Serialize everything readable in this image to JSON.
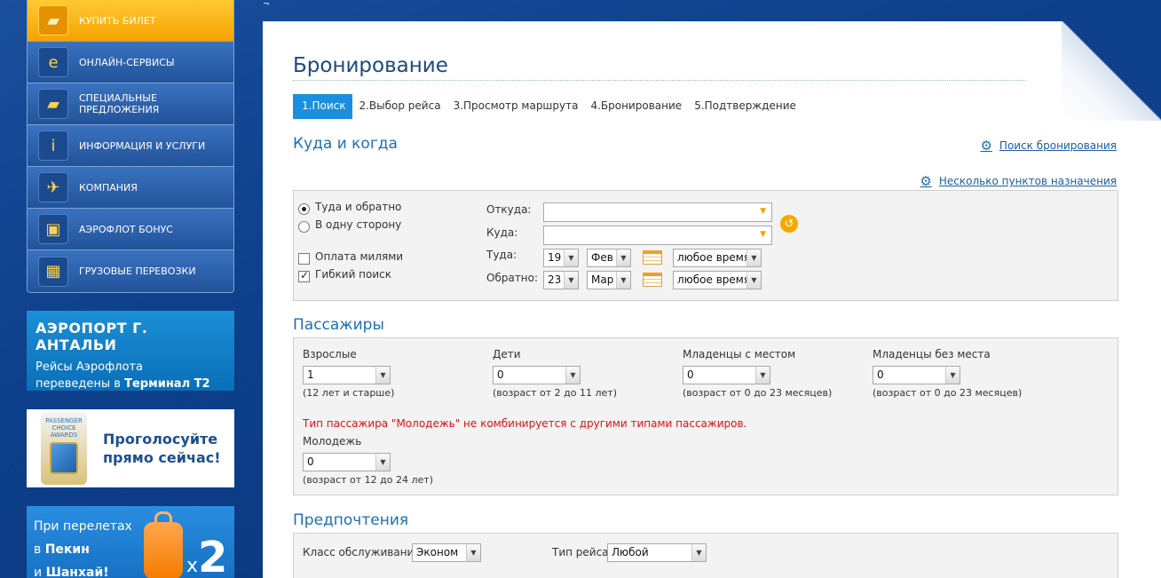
{
  "top_mark": "¬",
  "sidebar": {
    "items": [
      {
        "label": "КУПИТЬ БИЛЕТ",
        "icon": "ticket-icon",
        "glyph": "▰"
      },
      {
        "label": "ОНЛАЙН-СЕРВИСЫ",
        "icon": "ie-icon",
        "glyph": "e"
      },
      {
        "label": "СПЕЦИАЛЬНЫЕ ПРЕДЛОЖЕНИЯ",
        "icon": "tickets-icon",
        "glyph": "▰"
      },
      {
        "label": "ИНФОРМАЦИЯ И УСЛУГИ",
        "icon": "info-icon",
        "glyph": "i"
      },
      {
        "label": "КОМПАНИЯ",
        "icon": "plane-icon",
        "glyph": "✈"
      },
      {
        "label": "АЭРОФЛОТ БОНУС",
        "icon": "gift-icon",
        "glyph": "▣"
      },
      {
        "label": "ГРУЗОВЫЕ ПЕРЕВОЗКИ",
        "icon": "cargo-icon",
        "glyph": "▦"
      }
    ]
  },
  "banners": {
    "antalya": {
      "title": "АЭРОПОРТ Г. АНТАЛЬИ",
      "line1": "Рейсы Аэрофлота",
      "line2_prefix": "переведены в ",
      "line2_bold": "Терминал Т2"
    },
    "vote": {
      "award_text": "PASSENGER CHOICE AWARDS",
      "line1": "Проголосуйте",
      "line2": "прямо сейчас!"
    },
    "beijing": {
      "line1": "При перелетах",
      "line2_prefix": "в ",
      "line2_bold": "Пекин",
      "line3_prefix": "и ",
      "line3_bold": "Шанхай!",
      "multiplier_x": "x",
      "multiplier_n": "2"
    }
  },
  "page": {
    "title": "Бронирование",
    "steps": [
      "1.Поиск",
      "2.Выбор рейса",
      "3.Просмотр маршрута",
      "4.Бронирование",
      "5.Подтверждение"
    ],
    "active_step": 0
  },
  "when_where": {
    "title": "Куда и когда",
    "search_booking_link": "Поиск бронирования",
    "multi_city_link": "Несколько пунктов назначения",
    "round_trip_label": "Туда и обратно",
    "one_way_label": "В одну сторону",
    "trip_type": "round_trip",
    "pay_miles_label": "Оплата милями",
    "pay_miles_checked": false,
    "flexible_label": "Гибкий поиск",
    "flexible_checked": true,
    "from_label": "Откуда:",
    "from_value": "",
    "to_label": "Куда:",
    "to_value": "",
    "depart_label": "Туда:",
    "depart_day": "19",
    "depart_month": "Фев",
    "depart_time": "любое время",
    "return_label": "Обратно:",
    "return_day": "23",
    "return_month": "Мар",
    "return_time": "любое время"
  },
  "passengers": {
    "title": "Пассажиры",
    "adults_label": "Взрослые",
    "adults_value": "1",
    "adults_note": "(12 лет и старше)",
    "children_label": "Дети",
    "children_value": "0",
    "children_note": "(возраст от 2 до 11 лет)",
    "infants_seat_label": "Младенцы с местом",
    "infants_seat_value": "0",
    "infants_seat_note": "(возраст от 0 до 23 месяцев)",
    "infants_noseat_label": "Младенцы без места",
    "infants_noseat_value": "0",
    "infants_noseat_note": "(возраст от 0 до 23 месяцев)",
    "youth_warning": "Тип пассажира \"Молодежь\" не комбинируется с другими типами пассажиров.",
    "youth_label": "Молодежь",
    "youth_value": "0",
    "youth_note": "(возраст от 12 до 24 лет)"
  },
  "preferences": {
    "title": "Предпочтения",
    "class_label": "Класс обслуживания",
    "class_value": "Эконом",
    "flight_type_label": "Тип рейса",
    "flight_type_value": "Любой"
  },
  "colors": {
    "brand_blue": "#0d3f8a",
    "accent_orange": "#f5a300",
    "active_step": "#1a8fe0",
    "warning_red": "#e01010"
  }
}
